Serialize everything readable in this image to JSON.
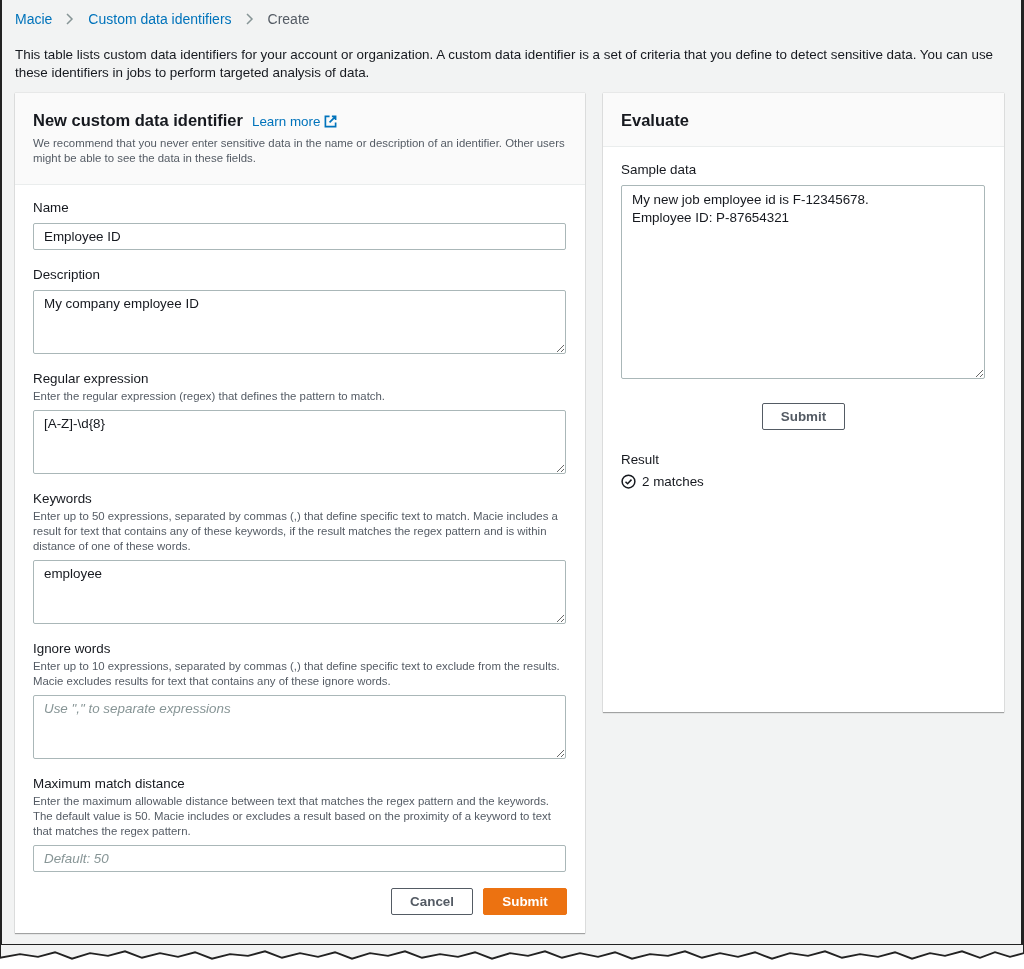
{
  "breadcrumb": [
    {
      "label": "Macie",
      "kind": "link"
    },
    {
      "label": "Custom data identifiers",
      "kind": "link"
    },
    {
      "label": "Create",
      "kind": "current"
    }
  ],
  "intro": "This table lists custom data identifiers for your account or organization. A custom data identifier is a set of criteria that you define to detect sensitive data. You can use these identifiers in jobs to perform targeted analysis of data.",
  "form": {
    "title": "New custom data identifier",
    "learn_more": "Learn more",
    "note": "We recommend that you never enter sensitive data in the name or description of an identifier. Other users might be able to see the data in these fields.",
    "fields": [
      {
        "kind": "input",
        "label": "Name",
        "value": "Employee ID"
      },
      {
        "kind": "textarea",
        "label": "Description",
        "value": "My company employee ID"
      },
      {
        "kind": "textarea",
        "label": "Regular expression",
        "hint": "Enter the regular expression (regex) that defines the pattern to match.",
        "value": "[A-Z]-\\d{8}"
      },
      {
        "kind": "textarea",
        "label": "Keywords",
        "hint": "Enter up to 50 expressions, separated by commas (,) that define specific text to match. Macie includes a result for text that contains any of these keywords, if the result matches the regex pattern and is within distance of one of these words.",
        "value": "employee"
      },
      {
        "kind": "textarea",
        "label": "Ignore words",
        "hint": "Enter up to 10 expressions, separated by commas (,) that define specific text to exclude from the results. Macie excludes results for text that contains any of these ignore words.",
        "placeholder": "Use \",\" to separate expressions"
      },
      {
        "kind": "number",
        "label": "Maximum match distance",
        "hint": "Enter the maximum allowable distance between text that matches the regex pattern and the keywords. The default value is 50. Macie includes or excludes a result based on the proximity of a keyword to text that matches the regex pattern.",
        "placeholder": "Default: 50"
      }
    ],
    "buttons": [
      {
        "label": "Cancel",
        "kind": "secondary"
      },
      {
        "label": "Submit",
        "kind": "primary"
      }
    ]
  },
  "evaluate": {
    "title": "Evaluate",
    "sample_label": "Sample data",
    "sample_value": "My new job employee id is F-12345678.\nEmployee ID: P-87654321",
    "submit": "Submit",
    "result_label": "Result",
    "result": "2 matches"
  }
}
